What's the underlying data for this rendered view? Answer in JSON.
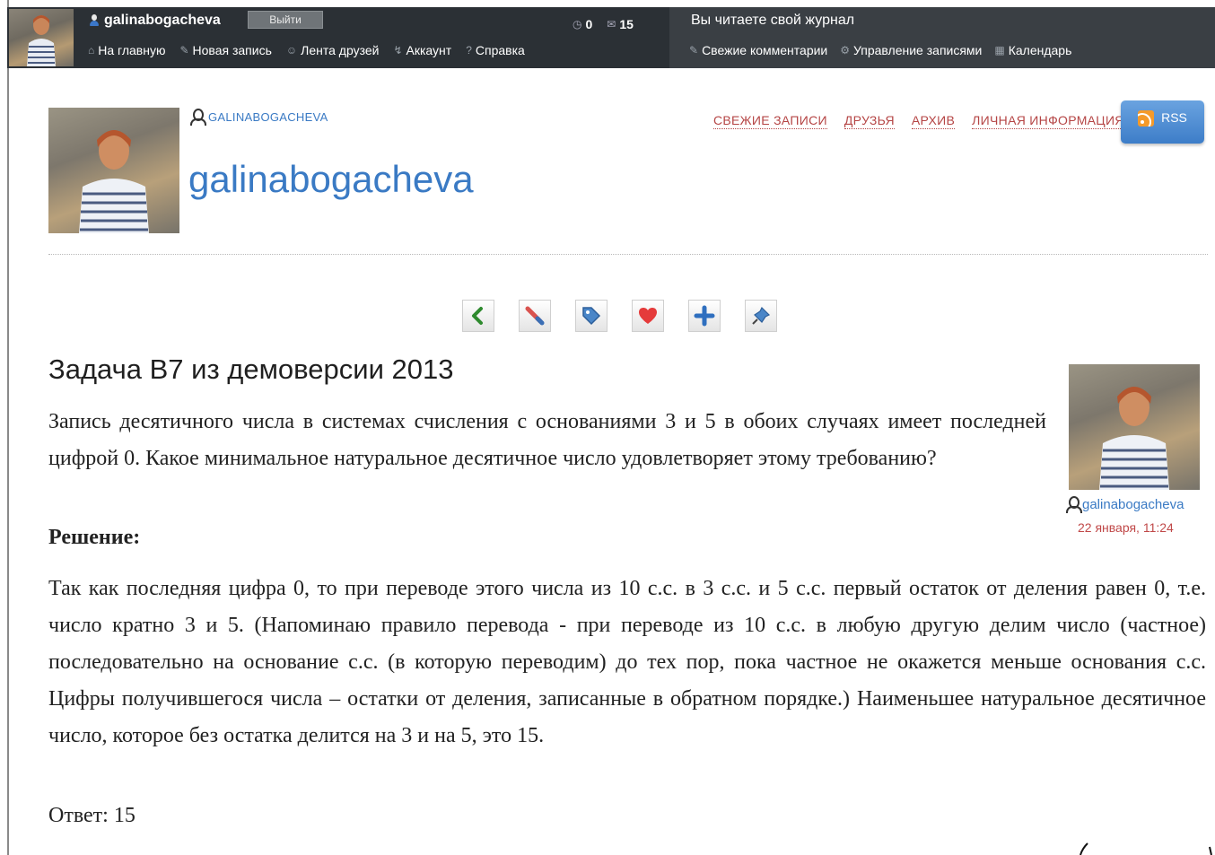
{
  "topbar": {
    "username": "galinabogacheva",
    "logout_label": "Выйти",
    "counters": [
      {
        "icon": "bubble-icon",
        "value": "0"
      },
      {
        "icon": "mail-icon",
        "value": "15"
      }
    ],
    "nav": [
      {
        "icon": "home-icon",
        "label": "На главную"
      },
      {
        "icon": "pencil-icon",
        "label": "Новая запись"
      },
      {
        "icon": "friends-icon",
        "label": "Лента друзей"
      },
      {
        "icon": "key-icon",
        "label": "Аккаунт"
      },
      {
        "icon": "help-icon",
        "label": "Справка"
      }
    ],
    "reading_notice": "Вы читаете свой журнал",
    "journal_nav": [
      {
        "icon": "comments-icon",
        "label": "Свежие комментарии"
      },
      {
        "icon": "manage-icon",
        "label": "Управление записями"
      },
      {
        "icon": "calendar-icon",
        "label": "Календарь"
      }
    ]
  },
  "journal": {
    "user_label": "GALINABOGACHEVA",
    "title": "galinabogacheva",
    "tabs": [
      "СВЕЖИЕ ЗАПИСИ",
      "ДРУЗЬЯ",
      "АРХИВ",
      "ЛИЧНАЯ ИНФОРМАЦИЯ"
    ],
    "rss_label": "RSS"
  },
  "actions": [
    {
      "name": "back-icon"
    },
    {
      "name": "edit-icon"
    },
    {
      "name": "tag-icon"
    },
    {
      "name": "heart-icon"
    },
    {
      "name": "plus-icon"
    },
    {
      "name": "pin-icon"
    }
  ],
  "entry": {
    "title": "Задача В7 из демоверсии 2013",
    "body": "Запись десятичного числа в системах счисления с основаниями 3 и 5 в обоих случаях имеет последней цифрой 0. Какое минимальное натуральное десятичное число удовлетворяет этому требованию?",
    "solution_heading": "Решение:",
    "solution": "Так как последняя цифра 0, то при переводе этого числа из 10 с.с. в 3 с.с. и 5 с.с. первый остаток от деления равен 0, т.е. число кратно 3 и 5. (Напоминаю правило перевода - при переводе из 10 с.с. в любую другую делим число (частное) последовательно на основание с.с. (в которую переводим) до тех пор, пока частное не окажется меньше основания с.с. Цифры получившегося числа – остатки от деления, записанные в обратном порядке.) Наименьшее натуральное десятичное число, которое без остатка делится на 3 и на 5, это 15.",
    "answer": "Ответ: 15",
    "author": "galinabogacheva",
    "date": "22 января, 11:24"
  }
}
